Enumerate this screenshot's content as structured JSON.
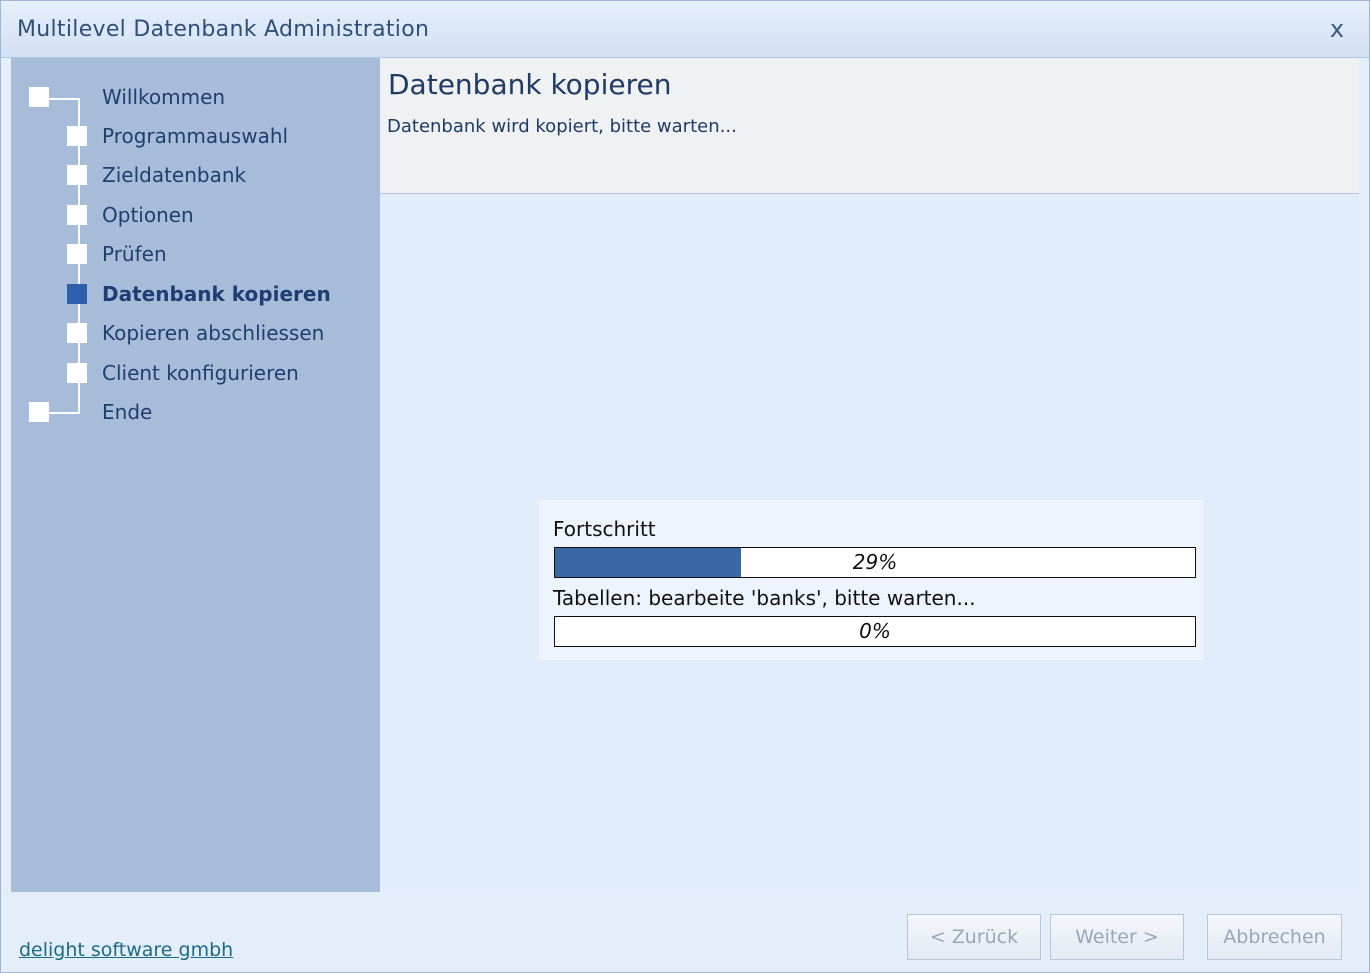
{
  "window": {
    "title": "Multilevel Datenbank Administration",
    "close_label": "x"
  },
  "sidebar": {
    "steps": [
      {
        "label": "Willkommen",
        "active": false
      },
      {
        "label": "Programmauswahl",
        "active": false
      },
      {
        "label": "Zieldatenbank",
        "active": false
      },
      {
        "label": "Optionen",
        "active": false
      },
      {
        "label": "Prüfen",
        "active": false
      },
      {
        "label": "Datenbank kopieren",
        "active": true
      },
      {
        "label": "Kopieren abschliessen",
        "active": false
      },
      {
        "label": "Client konfigurieren",
        "active": false
      },
      {
        "label": "Ende",
        "active": false
      }
    ]
  },
  "header": {
    "title": "Datenbank kopieren",
    "subtitle": "Datenbank wird kopiert, bitte warten..."
  },
  "progress": {
    "overall_label": "Fortschritt",
    "overall_value": 29,
    "overall_text": "29%",
    "table_label": "Tabellen: bearbeite 'banks', bitte warten...",
    "table_value": 0,
    "table_text": "0%"
  },
  "footer": {
    "company_link": "delight software gmbh",
    "back_button": "< Zurück",
    "next_button": "Weiter >",
    "cancel_button": "Abbrechen"
  },
  "colors": {
    "sidebar_bg": "#a7bcd9",
    "active_step": "#2d5faa",
    "progress_fill": "#3868a3",
    "link": "#1b6b84"
  }
}
